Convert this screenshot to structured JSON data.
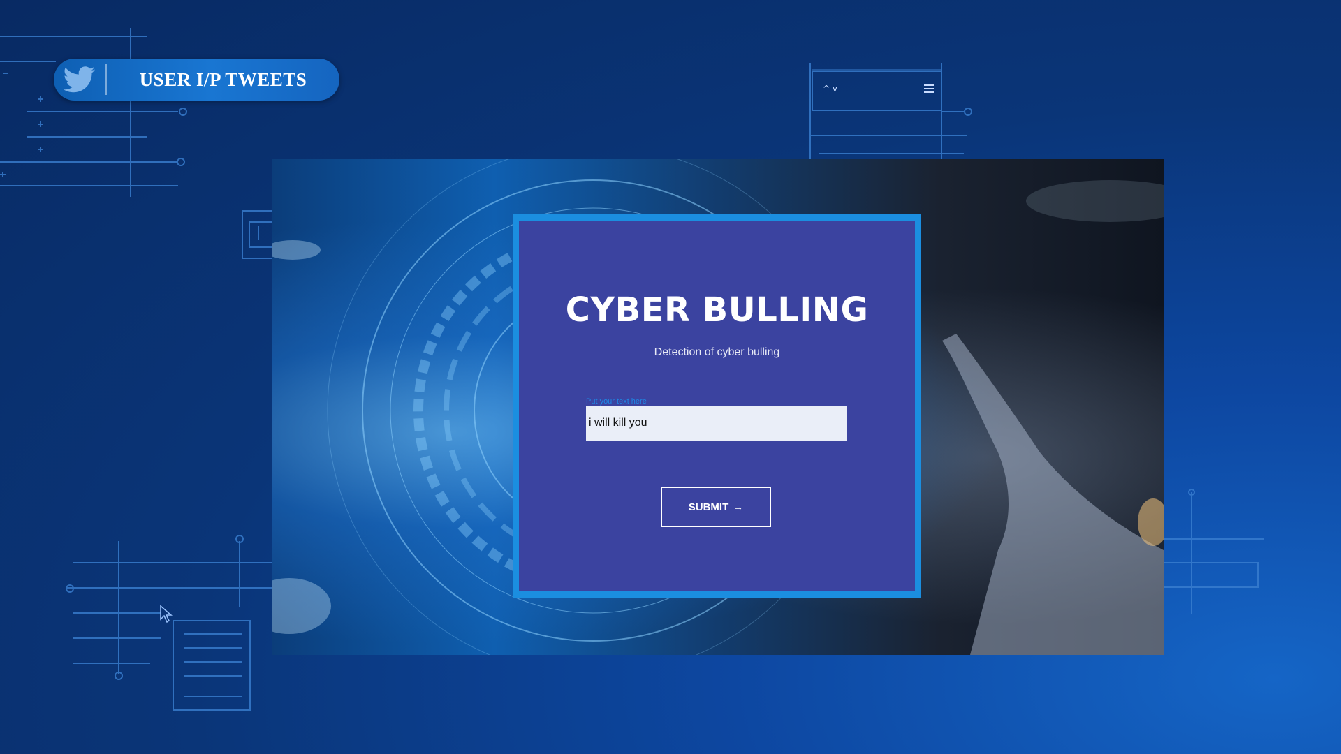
{
  "header": {
    "title": "USER I/P TWEETS",
    "logo_icon": "twitter-bird-icon"
  },
  "widget": {
    "arrows_glyph": "^ v",
    "menu_icon": "hamburger-icon"
  },
  "card": {
    "title": "CYBER BULLING",
    "subtitle": "Detection of cyber bulling",
    "input_label": "Put your text here",
    "input_value": "i will kill you",
    "submit_label": "SUBMIT",
    "submit_icon": "arrow-right-icon"
  },
  "colors": {
    "card_bg": "#3b43a0",
    "card_border": "#1b8ee0",
    "pill_bg": "#1976d2",
    "background": "#0a3578"
  }
}
